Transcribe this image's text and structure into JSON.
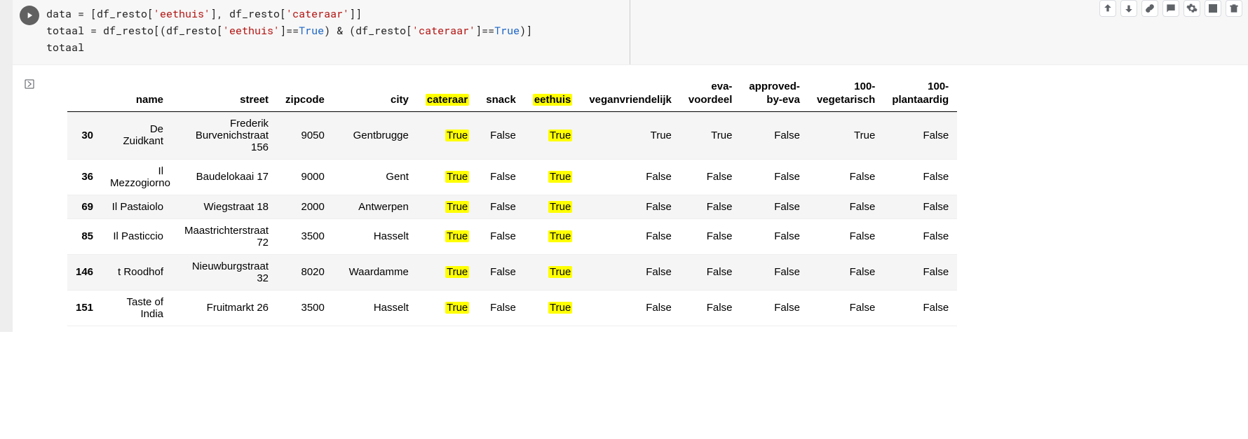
{
  "code": {
    "l1a": "data = [df_resto[",
    "l1s1": "'eethuis'",
    "l1b": "], df_resto[",
    "l1s2": "'cateraar'",
    "l1c": "]]",
    "l2a": "totaal = df_resto[(df_resto[",
    "l2s1": "'eethuis'",
    "l2b": "]==",
    "l2k1": "True",
    "l2c": ") & (df_resto[",
    "l2s2": "'cateraar'",
    "l2d": "]==",
    "l2k2": "True",
    "l2e": ")]",
    "l3": "totaal"
  },
  "headers": {
    "name": "name",
    "street": "street",
    "zipcode": "zipcode",
    "city": "city",
    "cateraar": "cateraar",
    "snack": "snack",
    "eethuis": "eethuis",
    "vegan": "veganvriendelijk",
    "eva1": "eva-",
    "eva2": "voordeel",
    "appr1": "approved-",
    "appr2": "by-eva",
    "veg1": "100-",
    "veg2": "vegetarisch",
    "plant1": "100-",
    "plant2": "plantaardig"
  },
  "rows": [
    {
      "idx": "30",
      "name": "De Zuidkant",
      "street": "Frederik Burvenichstraat 156",
      "zipcode": "9050",
      "city": "Gentbrugge",
      "cateraar": "True",
      "snack": "False",
      "eethuis": "True",
      "vegan": "True",
      "eva": "True",
      "appr": "False",
      "veg": "True",
      "plant": "False"
    },
    {
      "idx": "36",
      "name": "Il Mezzogiorno",
      "street": "Baudelokaai 17",
      "zipcode": "9000",
      "city": "Gent",
      "cateraar": "True",
      "snack": "False",
      "eethuis": "True",
      "vegan": "False",
      "eva": "False",
      "appr": "False",
      "veg": "False",
      "plant": "False"
    },
    {
      "idx": "69",
      "name": "Il Pastaiolo",
      "street": "Wiegstraat 18",
      "zipcode": "2000",
      "city": "Antwerpen",
      "cateraar": "True",
      "snack": "False",
      "eethuis": "True",
      "vegan": "False",
      "eva": "False",
      "appr": "False",
      "veg": "False",
      "plant": "False"
    },
    {
      "idx": "85",
      "name": "Il Pasticcio",
      "street": "Maastrichterstraat 72",
      "zipcode": "3500",
      "city": "Hasselt",
      "cateraar": "True",
      "snack": "False",
      "eethuis": "True",
      "vegan": "False",
      "eva": "False",
      "appr": "False",
      "veg": "False",
      "plant": "False"
    },
    {
      "idx": "146",
      "name": "t Roodhof",
      "street": "Nieuwburgstraat 32",
      "zipcode": "8020",
      "city": "Waardamme",
      "cateraar": "True",
      "snack": "False",
      "eethuis": "True",
      "vegan": "False",
      "eva": "False",
      "appr": "False",
      "veg": "False",
      "plant": "False"
    },
    {
      "idx": "151",
      "name": "Taste of India",
      "street": "Fruitmarkt 26",
      "zipcode": "3500",
      "city": "Hasselt",
      "cateraar": "True",
      "snack": "False",
      "eethuis": "True",
      "vegan": "False",
      "eva": "False",
      "appr": "False",
      "veg": "False",
      "plant": "False"
    }
  ]
}
